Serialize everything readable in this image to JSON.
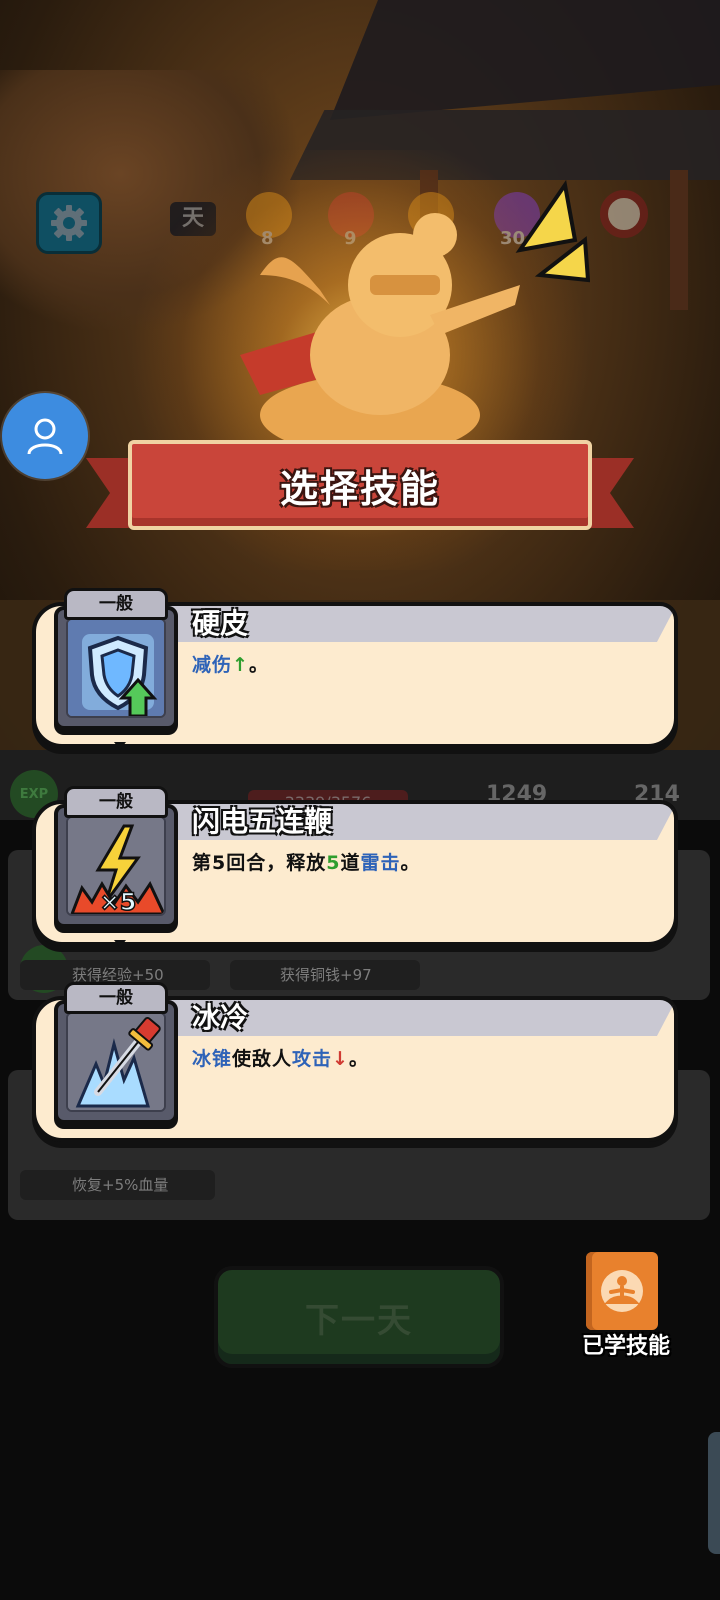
{
  "app": {
    "title": "选择技能"
  },
  "hud": {
    "day_label": "天",
    "counters": [
      {
        "name": "mystery-event",
        "value": "8",
        "color": "#d38a1a"
      },
      {
        "name": "battle",
        "value": "9",
        "color": "#b8362e"
      },
      {
        "name": "mystery-2",
        "value": "",
        "color": "#d38a1a"
      },
      {
        "name": "boss",
        "value": "30",
        "color": "#7a3ab8"
      }
    ]
  },
  "banner": {
    "title": "选择技能"
  },
  "skills": [
    {
      "rarity": "一般",
      "name": "硬皮",
      "icon": "shield-up-icon",
      "desc_parts": [
        {
          "text": "减伤",
          "color": "blue"
        },
        {
          "text": "↑",
          "color": "green"
        },
        {
          "text": "。",
          "color": "black"
        }
      ]
    },
    {
      "rarity": "一般",
      "name": "闪电五连鞭",
      "icon": "lightning-x5-icon",
      "desc_parts": [
        {
          "text": "第5回合，释放",
          "color": "black"
        },
        {
          "text": "5",
          "color": "green"
        },
        {
          "text": "道",
          "color": "black"
        },
        {
          "text": "雷击",
          "color": "blue"
        },
        {
          "text": "。",
          "color": "black"
        }
      ]
    },
    {
      "rarity": "一般",
      "name": "冰冷",
      "icon": "ice-sword-icon",
      "desc_parts": [
        {
          "text": "冰锥",
          "color": "blue"
        },
        {
          "text": "使敌人",
          "color": "black"
        },
        {
          "text": "攻击",
          "color": "blue"
        },
        {
          "text": "↓",
          "color": "red"
        },
        {
          "text": "。",
          "color": "black"
        }
      ]
    }
  ],
  "stats": {
    "exp_label": "EXP",
    "hp": "3339/3576",
    "attack": "1249",
    "defense": "214"
  },
  "rewards": {
    "exp_label": "EXP",
    "exp": "获得经验+50",
    "coin": "获得铜钱+97",
    "heal": "恢复+5%血量"
  },
  "actions": {
    "next_day": "下一天",
    "learned_skills": "已学技能"
  },
  "colors": {
    "banner": "#c9453a",
    "card_bg": "#fdebcf",
    "avatar": "#3d8ce0",
    "book": "#e8812d"
  }
}
